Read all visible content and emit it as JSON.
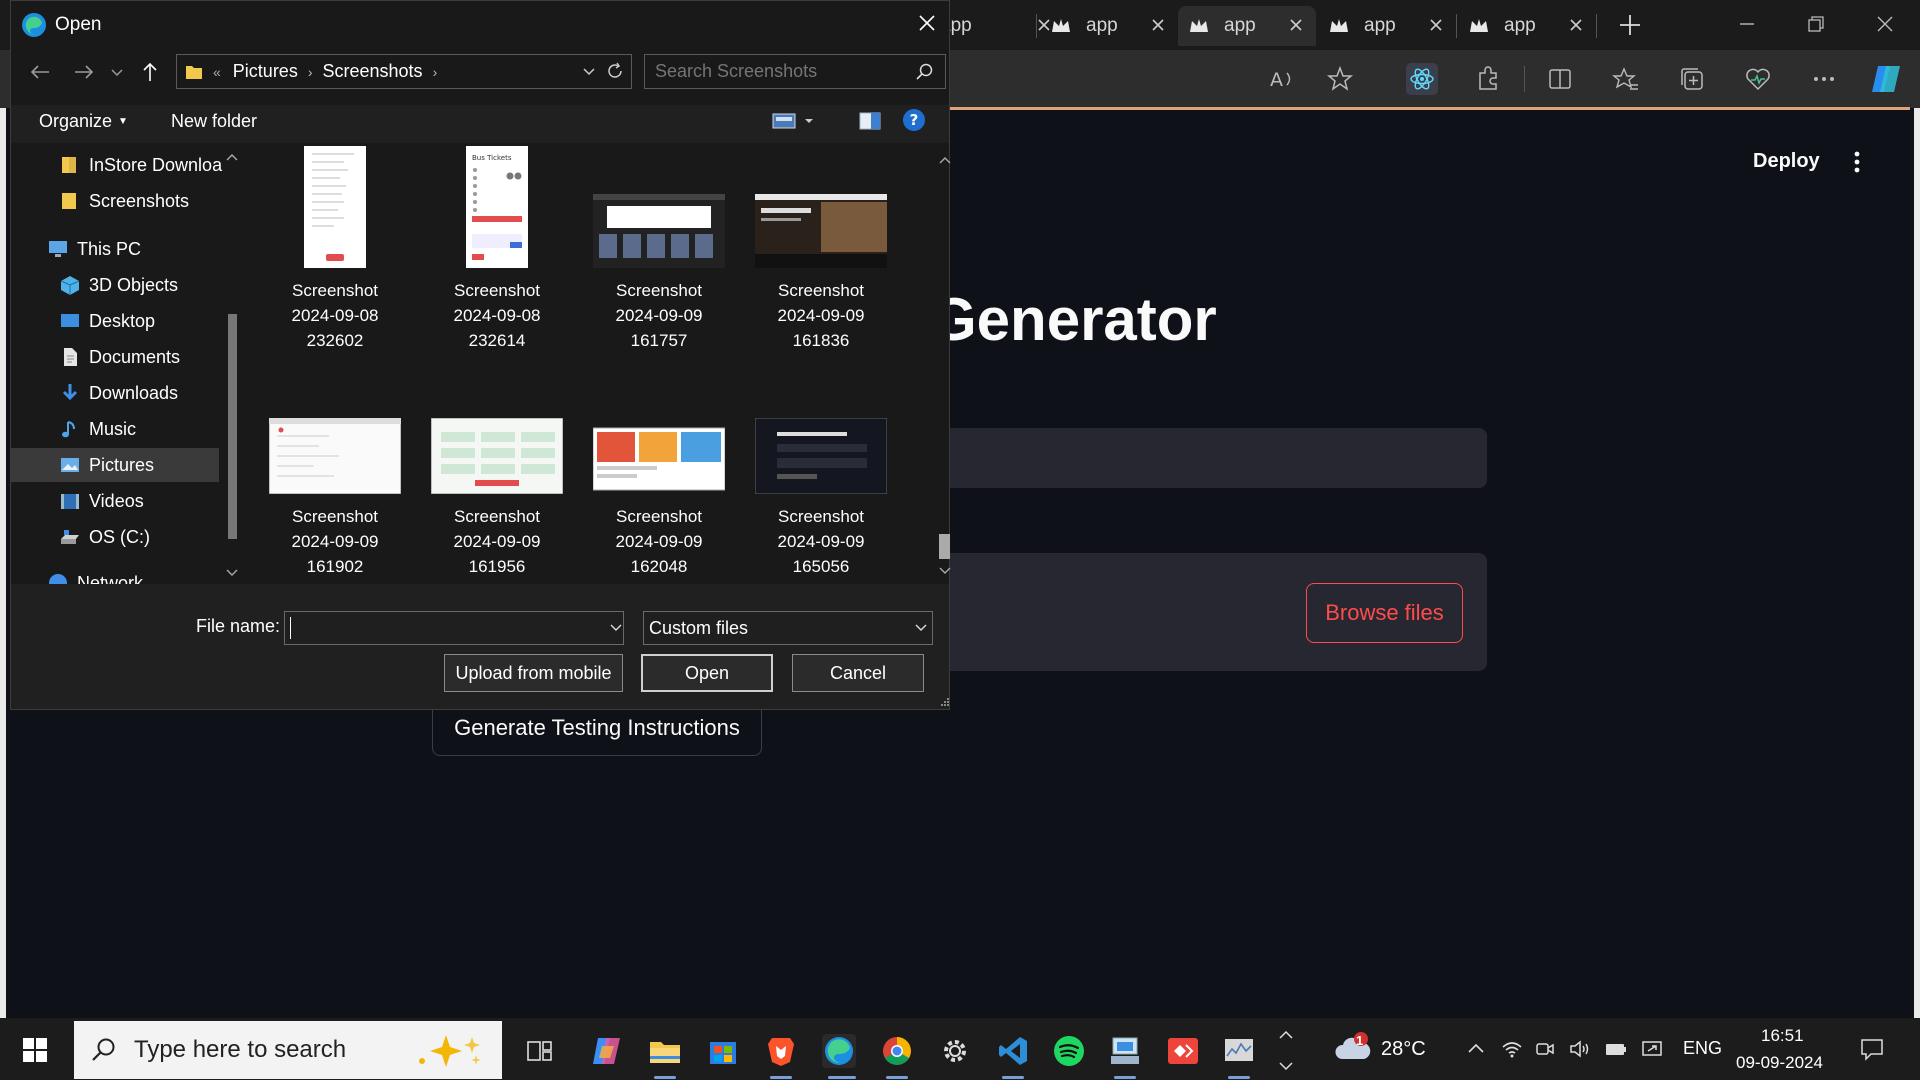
{
  "browser": {
    "tabs": [
      {
        "label": "app",
        "active": false
      },
      {
        "label": "app",
        "active": false
      },
      {
        "label": "app",
        "active": true
      },
      {
        "label": "app",
        "active": false
      },
      {
        "label": "app",
        "active": false
      }
    ],
    "page": {
      "deploy_label": "Deploy",
      "title_fragment": "uctions Generator",
      "browse_label": "Browse files",
      "generate_label": "Generate Testing Instructions"
    }
  },
  "dialog": {
    "title": "Open",
    "breadcrumb": [
      "Pictures",
      "Screenshots"
    ],
    "breadcrumb_prefix": "«",
    "search_placeholder": "Search Screenshots",
    "organize_label": "Organize",
    "new_folder_label": "New folder",
    "nav_items": [
      {
        "label": "InStore Downloa",
        "icon": "folder-icon"
      },
      {
        "label": "Screenshots",
        "icon": "folder-icon"
      },
      {
        "label": "This PC",
        "icon": "pc-icon"
      },
      {
        "label": "3D Objects",
        "icon": "cube-icon"
      },
      {
        "label": "Desktop",
        "icon": "desktop-icon"
      },
      {
        "label": "Documents",
        "icon": "document-icon"
      },
      {
        "label": "Downloads",
        "icon": "download-icon"
      },
      {
        "label": "Music",
        "icon": "music-icon"
      },
      {
        "label": "Pictures",
        "icon": "pictures-icon",
        "selected": true
      },
      {
        "label": "Videos",
        "icon": "videos-icon"
      },
      {
        "label": "OS (C:)",
        "icon": "drive-icon"
      },
      {
        "label": "Network",
        "icon": "network-icon"
      }
    ],
    "files": [
      {
        "line1": "Screenshot",
        "line2": "2024-09-08",
        "line3": "232602"
      },
      {
        "line1": "Screenshot",
        "line2": "2024-09-08",
        "line3": "232614"
      },
      {
        "line1": "Screenshot",
        "line2": "2024-09-09",
        "line3": "161757"
      },
      {
        "line1": "Screenshot",
        "line2": "2024-09-09",
        "line3": "161836"
      },
      {
        "line1": "Screenshot",
        "line2": "2024-09-09",
        "line3": "161902"
      },
      {
        "line1": "Screenshot",
        "line2": "2024-09-09",
        "line3": "161956"
      },
      {
        "line1": "Screenshot",
        "line2": "2024-09-09",
        "line3": "162048"
      },
      {
        "line1": "Screenshot",
        "line2": "2024-09-09",
        "line3": "165056"
      }
    ],
    "file_name_label": "File name:",
    "file_name_value": "",
    "filter_value": "Custom files",
    "upload_mobile_label": "Upload from mobile",
    "open_label": "Open",
    "cancel_label": "Cancel"
  },
  "taskbar": {
    "search_placeholder": "Type here to search",
    "weather_temp": "28°C",
    "weather_badge": "1",
    "language": "ENG",
    "time": "16:51",
    "date": "09-09-2024"
  },
  "colors": {
    "accent_red": "#ff4b4b",
    "page_bg": "#0e1117",
    "dialog_bg": "#191919"
  }
}
